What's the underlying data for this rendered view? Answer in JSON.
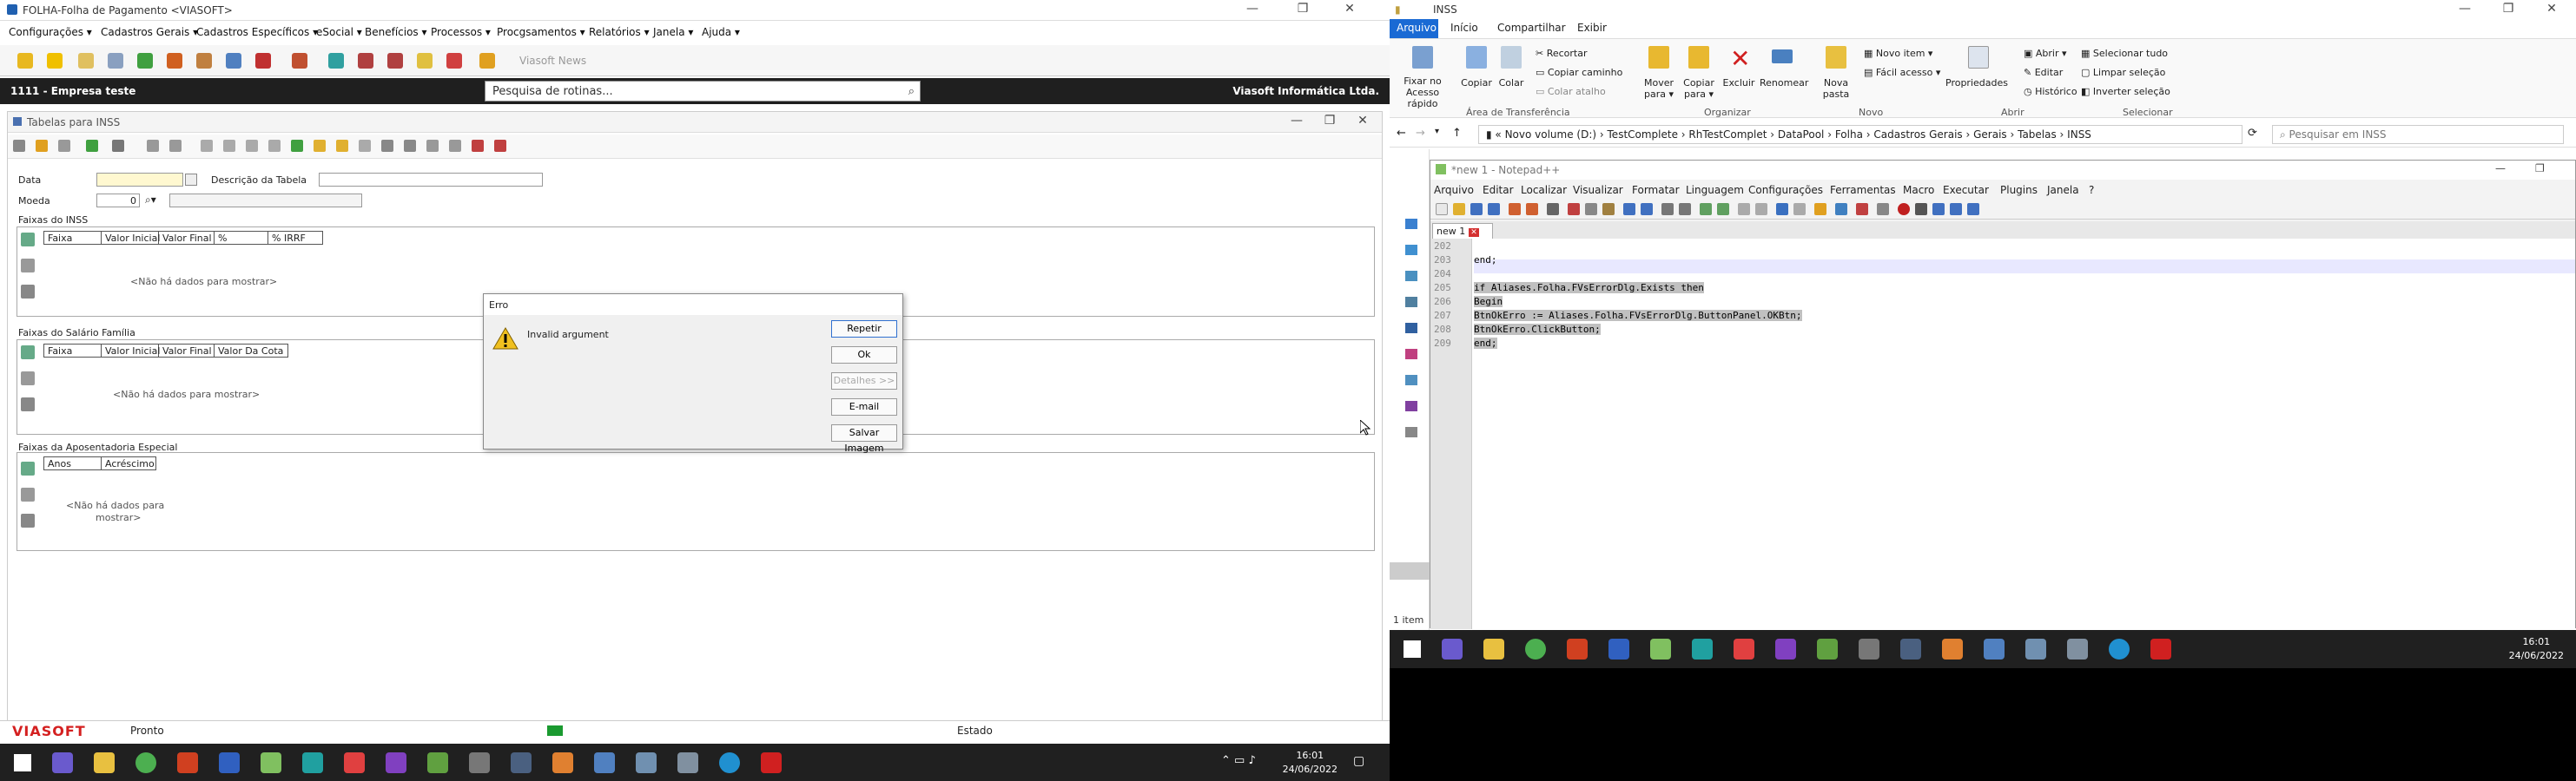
{
  "left": {
    "title": "FOLHA-Folha de Pagamento <VIASOFT>",
    "menu": [
      "Configurações ▾",
      "Cadastros Gerais ▾",
      "Cadastros Específicos ▾",
      "eSocial ▾",
      "Benefícios ▾",
      "Processos ▾",
      "Procgsamentos ▾",
      "Relatórios ▾",
      "Janela ▾",
      "Ajuda ▾"
    ],
    "news_label": "Viasoft News",
    "company": "1111 - Empresa teste",
    "search_placeholder": "Pesquisa de rotinas...",
    "vendor": "Viasoft Informática Ltda.",
    "inner_title": "Tabelas para INSS",
    "fields": {
      "data_label": "Data",
      "descricao_label": "Descrição da Tabela",
      "moeda_label": "Moeda",
      "moeda_value": "0"
    },
    "sections": {
      "inss": {
        "title": "Faixas do INSS",
        "columns": [
          "Faixa",
          "Valor Inicial",
          "Valor Final",
          "%",
          "% IRRF"
        ],
        "empty": "<Não há dados para mostrar>"
      },
      "salario_familia": {
        "title": "Faixas do Salário Família",
        "columns": [
          "Faixa",
          "Valor Inicial",
          "Valor Final",
          "Valor Da Cota"
        ],
        "empty": "<Não há dados para mostrar>"
      },
      "aposentadoria": {
        "title": "Faixas da Aposentadoria Especial",
        "columns": [
          "Anos",
          "Acréscimo"
        ],
        "empty_line1": "<Não há dados para",
        "empty_line2": "mostrar>"
      }
    },
    "dialog": {
      "title": "Erro",
      "message": "Invalid argument",
      "buttons": [
        "Repetir",
        "Ok",
        "Detalhes >>",
        "E-mail",
        "Salvar Imagem"
      ]
    },
    "status": {
      "logo": "VIASOFT",
      "state": "Pronto",
      "estado_label": "Estado",
      "status_color": "#1a9a30"
    },
    "clock": {
      "time": "16:01",
      "date": "24/06/2022"
    }
  },
  "right": {
    "explorer_title": "INSS",
    "tabs": [
      "Arquivo",
      "Início",
      "Compartilhar",
      "Exibir"
    ],
    "ribbon": {
      "fixar": "Fixar no\nAcesso rápido",
      "copiar": "Copiar",
      "colar": "Colar",
      "recortar": "Recortar",
      "copiar_caminho": "Copiar caminho",
      "colar_atalho": "Colar atalho",
      "mover": "Mover\npara ▾",
      "copiar_para": "Copiar\npara ▾",
      "excluir": "Excluir",
      "renomear": "Renomear",
      "nova_pasta": "Nova\npasta",
      "novo_item": "Novo item ▾",
      "facil_acesso": "Fácil acesso ▾",
      "propriedades": "Propriedades",
      "abrir": "Abrir ▾",
      "editar": "Editar",
      "historico": "Histórico",
      "selecionar_tudo": "Selecionar tudo",
      "limpar_selecao": "Limpar seleção",
      "inverter_selecao": "Inverter seleção",
      "groups": [
        "Área de Transferência",
        "Organizar",
        "Novo",
        "Abrir",
        "Selecionar"
      ]
    },
    "address": [
      "Novo volume (D:)",
      "TestComplete",
      "RhTestComplet",
      "DataPool",
      "Folha",
      "Cadastros Gerais",
      "Gerais",
      "Tabelas",
      "INSS"
    ],
    "search_placeholder": "Pesquisar em INSS",
    "items_count": "1 item",
    "npp": {
      "title": "*new 1 - Notepad++",
      "menu": [
        "Arquivo",
        "Editar",
        "Localizar",
        "Visualizar",
        "Formatar",
        "Linguagem",
        "Configurações",
        "Ferramentas",
        "Macro",
        "Executar",
        "Plugins",
        "Janela",
        "?"
      ],
      "tab": "new 1",
      "lines": [
        {
          "n": "202",
          "text": "",
          "sel": false
        },
        {
          "n": "203",
          "text": "end;",
          "sel": false
        },
        {
          "n": "204",
          "text": "",
          "sel": false
        },
        {
          "n": "205",
          "text": "if Aliases.Folha.FVsErrorDlg.Exists then",
          "sel": true
        },
        {
          "n": "206",
          "text": "Begin",
          "sel": true
        },
        {
          "n": "207",
          "text": "BtnOkErro := Aliases.Folha.FVsErrorDlg.ButtonPanel.OKBtn;",
          "sel": true
        },
        {
          "n": "208",
          "text": "BtnOkErro.ClickButton;",
          "sel": true
        },
        {
          "n": "209",
          "text": "end;",
          "sel": true
        }
      ]
    },
    "clock": {
      "time": "16:01",
      "date": "24/06/2022"
    }
  },
  "colors": {
    "accent": "#1a6ad4",
    "banner": "#1f1f1f",
    "logo": "#d42020",
    "taskbar": "#202020"
  }
}
